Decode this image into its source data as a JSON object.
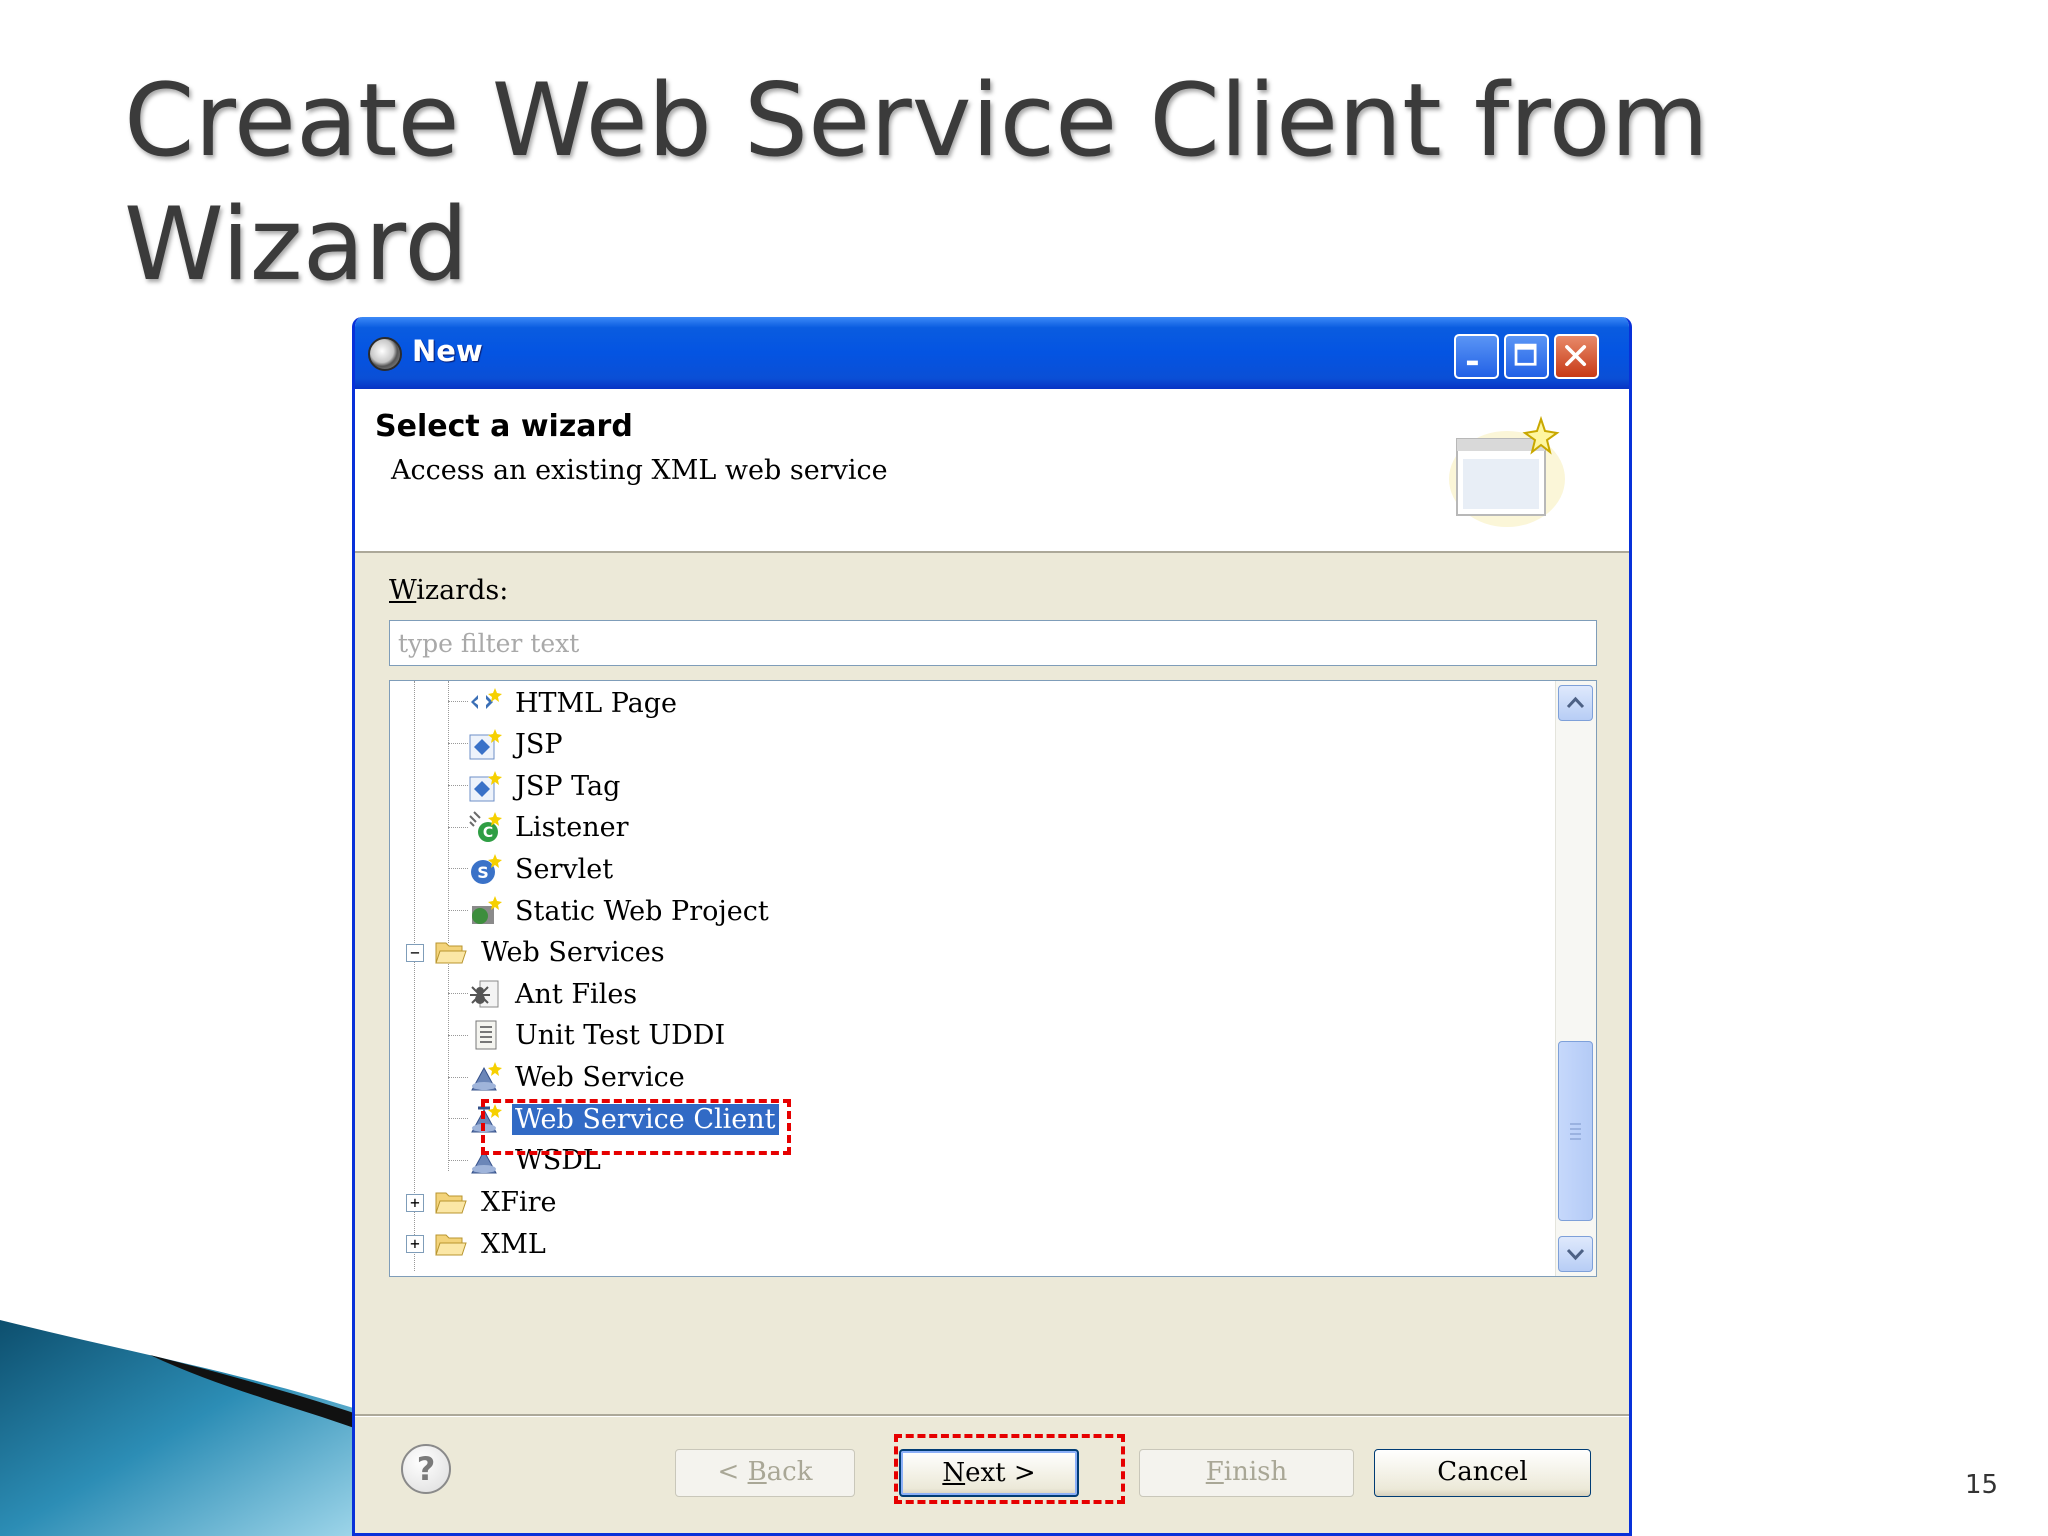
{
  "slide": {
    "title_line1": "Create Web Service Client from",
    "title_line2": "Wizard",
    "page_number": "15"
  },
  "window": {
    "title": "New",
    "icon": "eclipse-icon",
    "controls": [
      "minimize-icon",
      "maximize-icon",
      "close-icon"
    ]
  },
  "header": {
    "title": "Select a wizard",
    "description": "Access an existing XML web service",
    "banner_icon": "new-wizard-icon"
  },
  "wizards": {
    "label_mnemonic": "W",
    "label_rest": "izards:",
    "filter_placeholder": "type filter text",
    "filter_value": ""
  },
  "tree": {
    "items": [
      {
        "label": "HTML Page",
        "icon": "html-page-icon",
        "level": 2
      },
      {
        "label": "JSP",
        "icon": "jsp-icon",
        "level": 2
      },
      {
        "label": "JSP Tag",
        "icon": "jsp-tag-icon",
        "level": 2
      },
      {
        "label": "Listener",
        "icon": "listener-icon",
        "level": 2
      },
      {
        "label": "Servlet",
        "icon": "servlet-icon",
        "level": 2
      },
      {
        "label": "Static Web Project",
        "icon": "static-web-project-icon",
        "level": 2
      },
      {
        "label": "Web Services",
        "icon": "folder-open-icon",
        "level": 1,
        "expanded": true
      },
      {
        "label": "Ant Files",
        "icon": "ant-files-icon",
        "level": 2
      },
      {
        "label": "Unit Test UDDI",
        "icon": "unit-test-uddi-icon",
        "level": 2
      },
      {
        "label": "Web Service",
        "icon": "web-service-icon",
        "level": 2
      },
      {
        "label": "Web Service Client",
        "icon": "web-service-client-icon",
        "level": 2,
        "selected": true
      },
      {
        "label": "WSDL",
        "icon": "wsdl-icon",
        "level": 2
      },
      {
        "label": "XFire",
        "icon": "folder-icon",
        "level": 1,
        "expanded": false
      },
      {
        "label": "XML",
        "icon": "folder-icon",
        "level": 1,
        "expanded": false
      }
    ]
  },
  "buttons": {
    "help": "?",
    "back_prefix": "< ",
    "back_mnemonic": "B",
    "back_rest": "ack",
    "next_mnemonic": "N",
    "next_rest": "ext >",
    "finish_mnemonic": "F",
    "finish_rest": "inish",
    "cancel": "Cancel"
  },
  "colors": {
    "titlebar": "#0454e2",
    "selection": "#316ac5",
    "highlight_box": "#e60000",
    "dialog_bg": "#ece9d8"
  }
}
